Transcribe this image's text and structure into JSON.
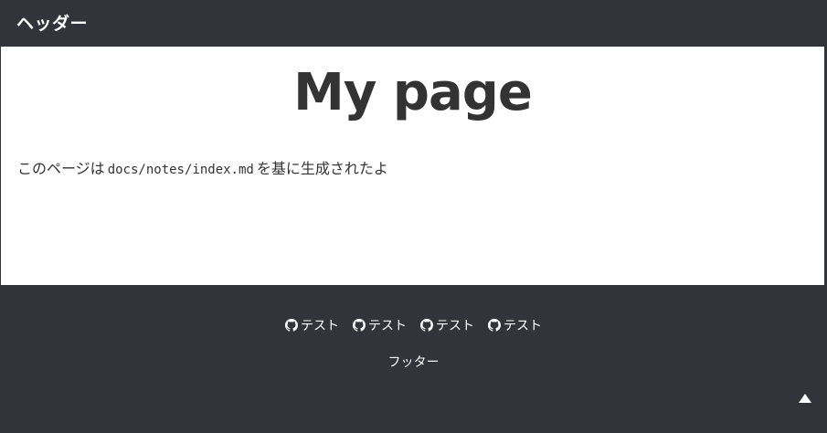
{
  "header": {
    "title": "ヘッダー"
  },
  "main": {
    "page_title": "My page",
    "body_prefix": "このページは",
    "body_code": "docs/notes/index.md",
    "body_suffix": "を基に生成されたよ"
  },
  "footer": {
    "links": [
      {
        "icon": "github-icon",
        "label": "テスト"
      },
      {
        "icon": "github-icon",
        "label": "テスト"
      },
      {
        "icon": "github-icon",
        "label": "テスト"
      },
      {
        "icon": "github-icon",
        "label": "テスト"
      }
    ],
    "text": "フッター",
    "scroll_top_icon": "triangle-up-icon"
  },
  "colors": {
    "dark_background": "#31353b",
    "content_background": "#ffffff",
    "text_dark": "#333333",
    "text_light": "#ffffff"
  }
}
